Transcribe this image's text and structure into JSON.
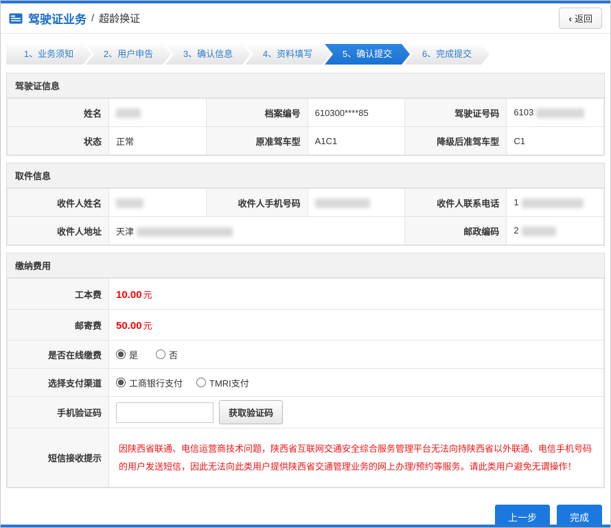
{
  "header": {
    "title": "驾驶证业务",
    "separator": "/",
    "subtitle": "超龄换证",
    "back_chevron": "‹",
    "back_label": "返回"
  },
  "steps": {
    "items": [
      {
        "label": "1、业务须知"
      },
      {
        "label": "2、用户申告"
      },
      {
        "label": "3、确认信息"
      },
      {
        "label": "4、资料填写"
      },
      {
        "label": "5、确认提交"
      },
      {
        "label": "6、完成提交"
      }
    ],
    "active_label": "5、确认提交"
  },
  "license_info": {
    "title": "驾驶证信息",
    "name_label": "姓名",
    "archive_label": "档案编号",
    "archive_value": "610300****85",
    "license_no_label": "驾驶证号码",
    "license_no_value": "6103",
    "status_label": "状态",
    "status_value": "正常",
    "original_type_label": "原准驾车型",
    "original_type_value": "A1C1",
    "downgraded_type_label": "降级后准驾车型",
    "downgraded_type_value": "C1"
  },
  "pickup_info": {
    "title": "取件信息",
    "recipient_name_label": "收件人姓名",
    "recipient_phone_label": "收件人手机号码",
    "recipient_tel_label": "收件人联系电话",
    "recipient_tel_value": "1",
    "address_label": "收件人地址",
    "address_value": "天津",
    "postcode_label": "邮政编码",
    "postcode_value": "2"
  },
  "fees": {
    "title": "缴纳费用",
    "production_fee_label": "工本费",
    "production_fee_value": "10.00",
    "production_fee_unit": "元",
    "postage_label": "邮寄费",
    "postage_value": "50.00",
    "postage_unit": "元",
    "online_payment_label": "是否在线缴费",
    "online_yes_label": "是",
    "online_no_label": "否",
    "online_selected": "是",
    "channel_label": "选择支付渠道",
    "channel_icbc_label": "工商银行支付",
    "channel_tmri_label": "TMRI支付",
    "channel_selected": "工商银行支付",
    "sms_code_label": "手机验证码",
    "get_code_button": "获取验证码",
    "sms_notice_label": "短信接收提示",
    "sms_notice_text": "因陕西省联通、电信运营商技术问题，陕西省互联网交通安全综合服务管理平台无法向持陕西省以外联通、电信手机号码的用户发送短信，因此无法向此类用户提供陕西省交通管理业务的网上办理/预约等服务。请此类用户避免无谓操作！"
  },
  "footer": {
    "prev_button": "上一步",
    "finish_button": "完成"
  },
  "colors": {
    "accent_blue": "#1b78e0",
    "tab_blue": "#1a71d2",
    "fee_red": "#fe0000",
    "warning_red": "#f21414"
  }
}
